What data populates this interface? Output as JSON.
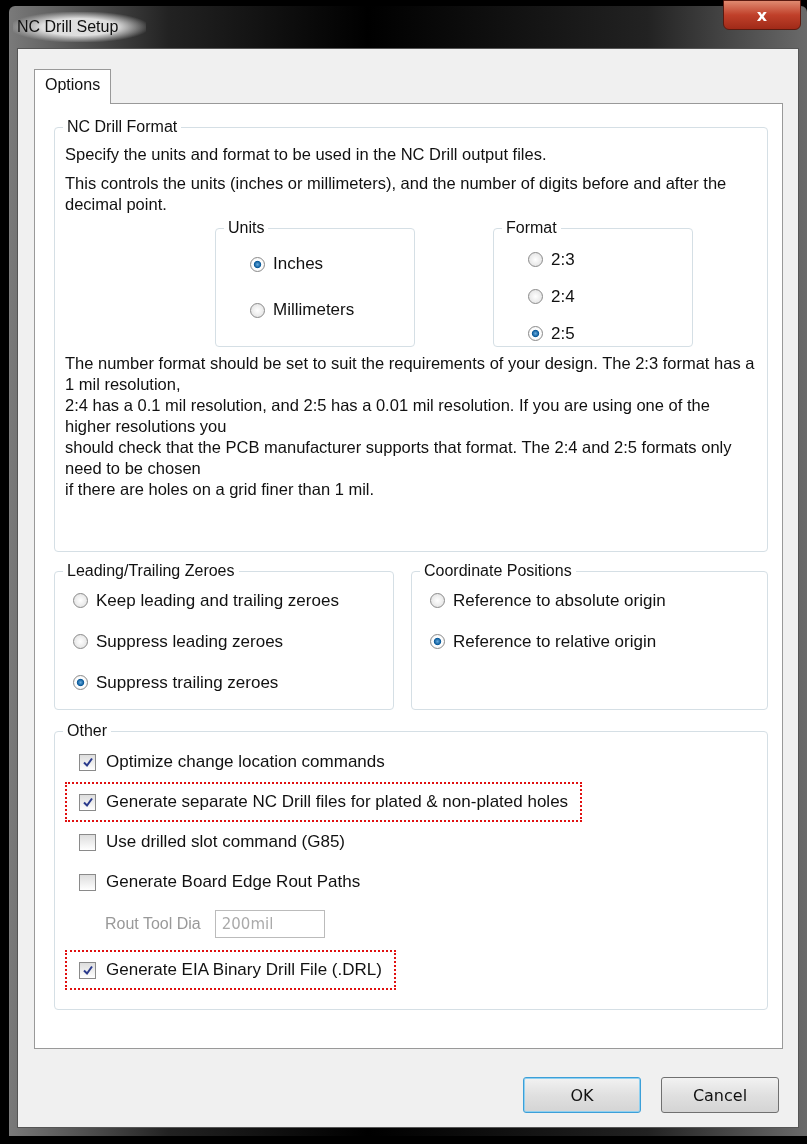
{
  "window": {
    "title": "NC Drill Setup",
    "close_label": "x"
  },
  "tabs": [
    {
      "label": "Options",
      "selected": true
    }
  ],
  "nc_drill_format": {
    "title": "NC Drill Format",
    "intro": "Specify the units and format to be used in the NC Drill output files.",
    "description": "This controls the units (inches or millimeters), and the number of digits before and after the decimal point.",
    "units": {
      "title": "Units",
      "options": [
        {
          "label": "Inches",
          "selected": true
        },
        {
          "label": "Millimeters",
          "selected": false
        }
      ]
    },
    "format": {
      "title": "Format",
      "options": [
        {
          "label": "2:3",
          "selected": false
        },
        {
          "label": "2:4",
          "selected": false
        },
        {
          "label": "2:5",
          "selected": true
        }
      ]
    },
    "note": "The number format should be set to suit the requirements of your design. The 2:3 format has a 1 mil resolution,\n2:4 has a 0.1 mil resolution, and 2:5 has a 0.01 mil resolution. If you are using one of the higher resolutions you\nshould check that the PCB manufacturer supports that format. The 2:4 and 2:5 formats only need to be chosen\nif there are holes on a grid finer than 1 mil."
  },
  "leading_trailing_zeroes": {
    "title": "Leading/Trailing Zeroes",
    "options": [
      {
        "label": "Keep leading and trailing zeroes",
        "selected": false
      },
      {
        "label": "Suppress leading zeroes",
        "selected": false
      },
      {
        "label": "Suppress trailing zeroes",
        "selected": true
      }
    ]
  },
  "coordinate_positions": {
    "title": "Coordinate Positions",
    "options": [
      {
        "label": "Reference to absolute origin",
        "selected": false
      },
      {
        "label": "Reference to relative origin",
        "selected": true
      }
    ]
  },
  "other": {
    "title": "Other",
    "items": [
      {
        "kind": "checkbox",
        "label": "Optimize change location commands",
        "checked": true,
        "highlighted": false
      },
      {
        "kind": "checkbox",
        "label": "Generate separate NC Drill files for plated & non-plated holes",
        "checked": true,
        "highlighted": true
      },
      {
        "kind": "checkbox",
        "label": "Use drilled slot command (G85)",
        "checked": false,
        "highlighted": false
      },
      {
        "kind": "checkbox",
        "label": "Generate Board Edge Rout Paths",
        "checked": false,
        "highlighted": false
      },
      {
        "kind": "field",
        "label": "Rout Tool Dia",
        "value": "200mil",
        "disabled": true
      },
      {
        "kind": "checkbox",
        "label": "Generate EIA Binary Drill File (.DRL)",
        "checked": true,
        "highlighted": true
      }
    ]
  },
  "buttons": [
    {
      "label": "OK",
      "default": true
    },
    {
      "label": "Cancel",
      "default": false
    }
  ]
}
